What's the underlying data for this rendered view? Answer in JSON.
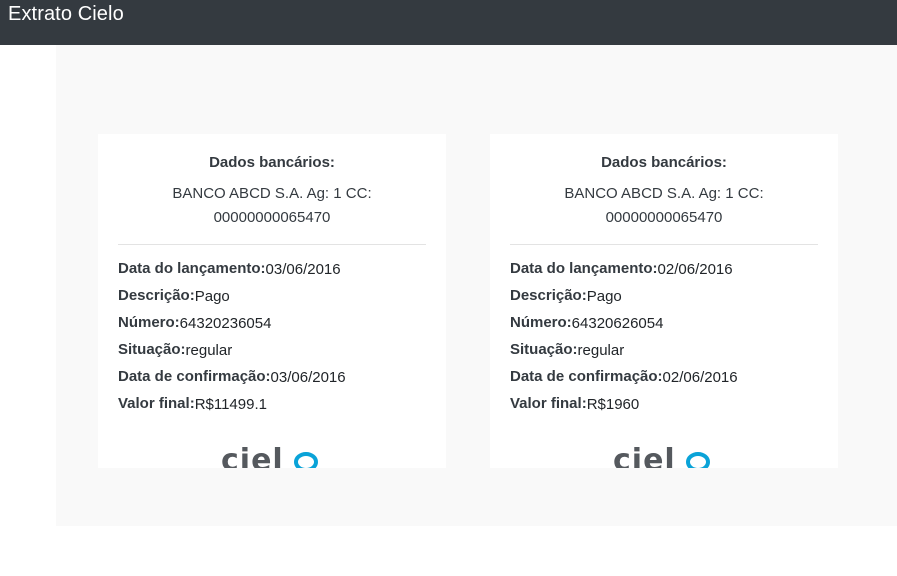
{
  "app": {
    "title": "Extrato Cielo"
  },
  "labels": {
    "dados_bancarios": "Dados bancários:",
    "data_lancamento": "Data do lançamento:",
    "descricao": "Descrição:",
    "numero": "Número:",
    "situacao": "Situação:",
    "data_confirmacao": "Data de confirmação:",
    "valor_final": "Valor final:"
  },
  "logo_text": "cielo",
  "colors": {
    "topbar": "#343a40",
    "panel": "#f9f9f9",
    "logo_gray": "#55595e",
    "logo_blue": "#0aa3d8"
  },
  "cards": [
    {
      "bank_line1": "BANCO ABCD S.A. Ag: 1 CC:",
      "bank_line2": "00000000065470",
      "data_lancamento": "03/06/2016",
      "descricao": "Pago",
      "numero": "64320236054",
      "situacao": "regular",
      "data_confirmacao": "03/06/2016",
      "valor_final": "R$11499.1"
    },
    {
      "bank_line1": "BANCO ABCD S.A. Ag: 1 CC:",
      "bank_line2": "00000000065470",
      "data_lancamento": "02/06/2016",
      "descricao": "Pago",
      "numero": "64320626054",
      "situacao": "regular",
      "data_confirmacao": "02/06/2016",
      "valor_final": "R$1960"
    }
  ]
}
